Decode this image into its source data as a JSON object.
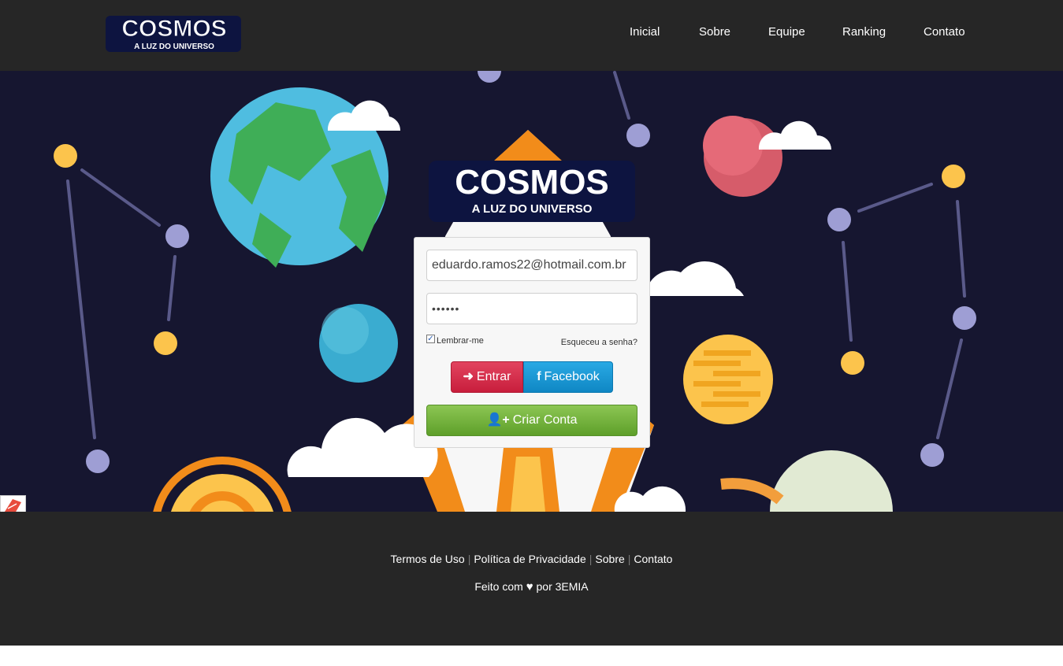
{
  "brand": {
    "title": "COSMOS",
    "tagline": "A LUZ DO UNIVERSO"
  },
  "nav": {
    "items": [
      "Inicial",
      "Sobre",
      "Equipe",
      "Ranking",
      "Contato"
    ]
  },
  "login": {
    "email_value": "eduardo.ramos22@hotmail.com.br",
    "password_value": "••••••",
    "remember_label": "Lembrar-me",
    "remember_checked": true,
    "forgot_label": "Esqueceu a senha?",
    "enter_label": "Entrar",
    "facebook_label": "Facebook",
    "create_label": "Criar Conta"
  },
  "footer": {
    "links": [
      "Termos de Uso",
      "Política de Privacidade",
      "Sobre",
      "Contato"
    ],
    "made_prefix": "Feito com",
    "made_suffix": "por 3EMIA"
  },
  "colors": {
    "topbar": "#262626",
    "hero_bg": "#161630",
    "enter_button": "#d42a48",
    "facebook_button": "#1a97d4",
    "create_button": "#72b23c"
  }
}
